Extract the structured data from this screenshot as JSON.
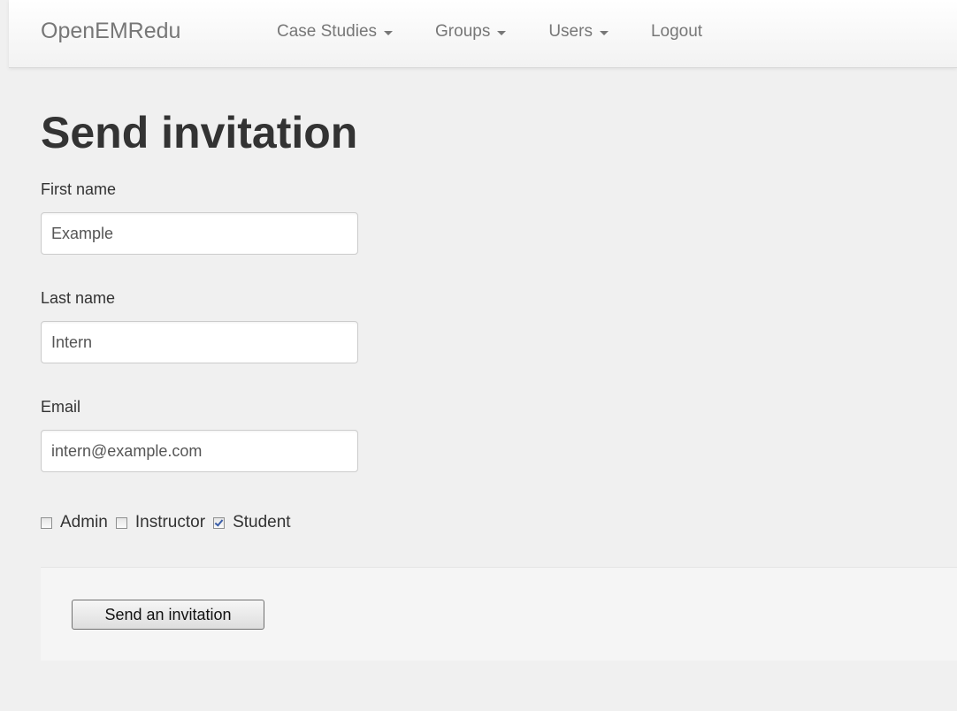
{
  "navbar": {
    "brand": "OpenEMRedu",
    "items": [
      {
        "label": "Case Studies",
        "has_caret": true
      },
      {
        "label": "Groups",
        "has_caret": true
      },
      {
        "label": "Users",
        "has_caret": true
      },
      {
        "label": "Logout",
        "has_caret": false
      }
    ]
  },
  "page": {
    "title": "Send invitation"
  },
  "form": {
    "first_name": {
      "label": "First name",
      "value": "Example"
    },
    "last_name": {
      "label": "Last name",
      "value": "Intern"
    },
    "email": {
      "label": "Email",
      "value": "intern@example.com"
    },
    "roles": [
      {
        "label": "Admin",
        "checked": false
      },
      {
        "label": "Instructor",
        "checked": false
      },
      {
        "label": "Student",
        "checked": true
      }
    ],
    "submit_label": "Send an invitation"
  }
}
